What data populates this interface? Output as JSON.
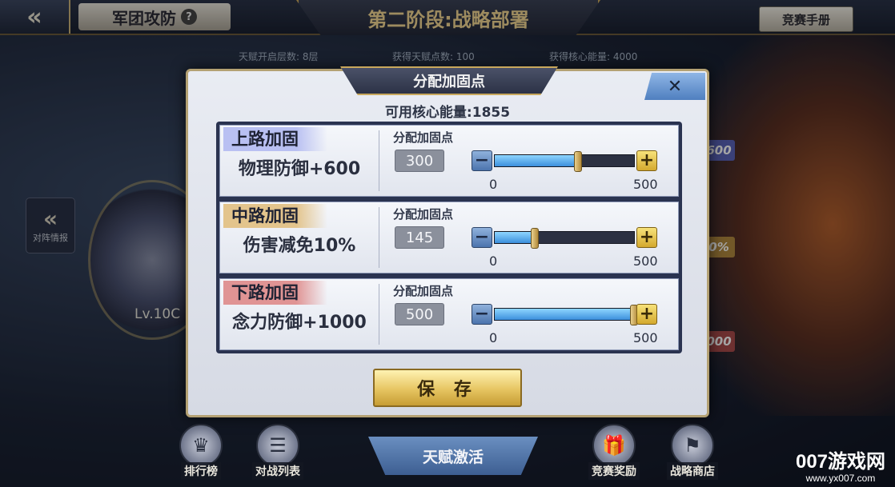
{
  "header": {
    "back_glyph": "«",
    "mode_title": "军团攻防",
    "help_glyph": "?",
    "stage_title": "第二阶段:战略部署",
    "manual_button": "竞赛手册"
  },
  "info": {
    "talent_layers": "天赋开启层数: 8层",
    "talent_points": "获得天赋点数: 100",
    "core_energy": "获得核心能量: 4000"
  },
  "side": {
    "intel_label": "对阵情报",
    "level_text": "Lv.10C",
    "chips": [
      "600",
      "0%",
      "000"
    ]
  },
  "modal": {
    "title": "分配加固点",
    "close_glyph": "✕",
    "available_energy": "可用核心能量:1855",
    "save_label": "保 存",
    "lanes": [
      {
        "tag": "上路加固",
        "tag_color": "#b9c0f2",
        "effect": "物理防御+600",
        "alloc_label": "分配加固点",
        "value": "300",
        "fraction": 0.6,
        "min": "0",
        "max": "500"
      },
      {
        "tag": "中路加固",
        "tag_color": "#e3c48c",
        "effect": "伤害减免10%",
        "alloc_label": "分配加固点",
        "value": "145",
        "fraction": 0.29,
        "min": "0",
        "max": "500"
      },
      {
        "tag": "下路加固",
        "tag_color": "#e09494",
        "effect": "念力防御+1000",
        "alloc_label": "分配加固点",
        "value": "500",
        "fraction": 1.0,
        "min": "0",
        "max": "500"
      }
    ]
  },
  "bottom_nav": {
    "ranking": "排行榜",
    "battle_list": "对战列表",
    "activate": "天赋激活",
    "rewards": "竞赛奖励",
    "shop": "战略商店"
  },
  "watermark": {
    "big": "007游戏网",
    "small": "www.yx007.com"
  }
}
